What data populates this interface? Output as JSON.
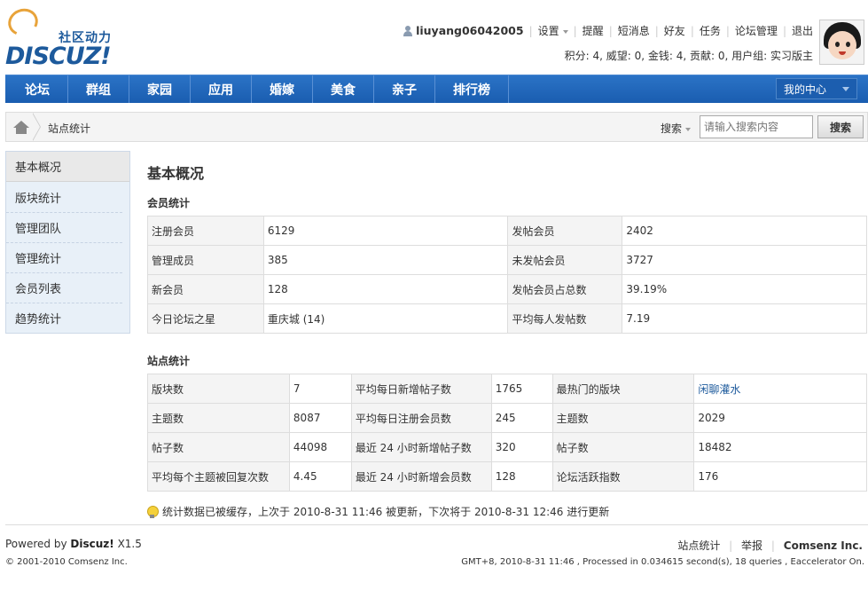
{
  "header": {
    "logo_slogan": "社区动力",
    "logo_brand": "DISCUZ!",
    "username": "liuyang06042005",
    "links": [
      "设置",
      "提醒",
      "短消息",
      "好友",
      "任务",
      "论坛管理",
      "退出"
    ],
    "credits": "积分: 4, 威望: 0, 金钱: 4, 贡献: 0, 用户组: 实习版主"
  },
  "nav": {
    "items": [
      "论坛",
      "群组",
      "家园",
      "应用",
      "婚嫁",
      "美食",
      "亲子",
      "排行榜"
    ],
    "my_center": "我的中心"
  },
  "breadcrumb": {
    "current": "站点统计",
    "search_type": "搜索",
    "search_placeholder": "请输入搜索内容",
    "search_button": "搜索"
  },
  "sidebar": {
    "items": [
      "基本概况",
      "版块统计",
      "管理团队",
      "管理统计",
      "会员列表",
      "趋势统计"
    ]
  },
  "main": {
    "title": "基本概况",
    "member_section_title": "会员统计",
    "member_rows": [
      [
        {
          "l": "注册会员",
          "v": "6129"
        },
        {
          "l": "发帖会员",
          "v": "2402"
        }
      ],
      [
        {
          "l": "管理成员",
          "v": "385"
        },
        {
          "l": "未发帖会员",
          "v": "3727"
        }
      ],
      [
        {
          "l": "新会员",
          "v": "128"
        },
        {
          "l": "发帖会员占总数",
          "v": "39.19%"
        }
      ],
      [
        {
          "l": "今日论坛之星",
          "v": "重庆城 (14)"
        },
        {
          "l": "平均每人发帖数",
          "v": "7.19"
        }
      ]
    ],
    "site_section_title": "站点统计",
    "site_rows": [
      [
        {
          "l": "版块数",
          "v": "7"
        },
        {
          "l": "平均每日新增帖子数",
          "v": "1765"
        },
        {
          "l": "最热门的版块",
          "v": "闲聊灌水"
        }
      ],
      [
        {
          "l": "主题数",
          "v": "8087"
        },
        {
          "l": "平均每日注册会员数",
          "v": "245"
        },
        {
          "l": "主题数",
          "v": "2029"
        }
      ],
      [
        {
          "l": "帖子数",
          "v": "44098"
        },
        {
          "l": "最近 24 小时新增帖子数",
          "v": "320"
        },
        {
          "l": "帖子数",
          "v": "18482"
        }
      ],
      [
        {
          "l": "平均每个主题被回复次数",
          "v": "4.45"
        },
        {
          "l": "最近 24 小时新增会员数",
          "v": "128"
        },
        {
          "l": "论坛活跃指数",
          "v": "176"
        }
      ]
    ],
    "notice": "统计数据已被缓存，上次于 2010-8-31 11:46 被更新，下次将于 2010-8-31 12:46 进行更新"
  },
  "footer": {
    "powered_prefix": "Powered by",
    "powered_brand": "Discuz!",
    "powered_version": "X1.5",
    "copyright": "© 2001-2010 Comsenz Inc.",
    "link_stats": "站点统计",
    "link_report": "举报",
    "link_company": "Comsenz Inc.",
    "debug": "GMT+8, 2010-8-31 11:46 , Processed in 0.034615 second(s), 18 queries , Eaccelerator On."
  },
  "colors": {
    "nav_blue": "#1a5db0",
    "brand_blue": "#1d5a9c",
    "link_blue": "#1d5a9c"
  }
}
